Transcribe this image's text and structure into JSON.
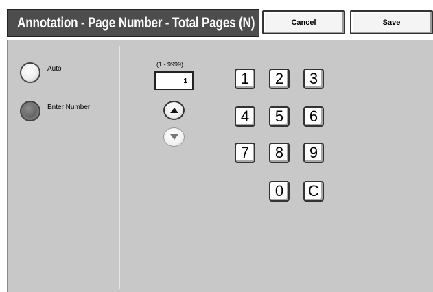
{
  "header": {
    "title": "Annotation - Page Number - Total Pages (N)",
    "cancel_label": "Cancel",
    "save_label": "Save"
  },
  "options": {
    "auto_label": "Auto",
    "enter_number_label": "Enter Number",
    "selected": "Enter Number"
  },
  "number_input": {
    "range_label": "(1 - 9999)",
    "value": "1"
  },
  "keypad": {
    "k1": "1",
    "k2": "2",
    "k3": "3",
    "k4": "4",
    "k5": "5",
    "k6": "6",
    "k7": "7",
    "k8": "8",
    "k9": "9",
    "k0": "0",
    "clear": "C"
  },
  "icons": {
    "increment": "triangle-up-icon",
    "decrement": "triangle-down-icon"
  }
}
